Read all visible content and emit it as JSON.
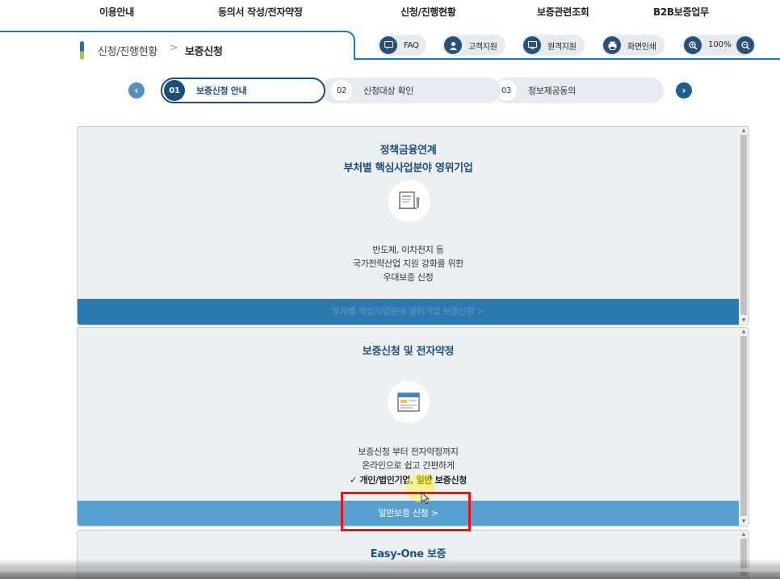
{
  "topnav": {
    "items": [
      "이용안내",
      "동의서 작성/전자약정",
      "신청/진행현황",
      "보증관련조회",
      "B2B보증업무"
    ]
  },
  "breadcrumb": {
    "parent": "신청/진행현황",
    "separator": ">",
    "current": "보증신청"
  },
  "tools": {
    "faq": "FAQ",
    "support": "고객지원",
    "remote": "원격지원",
    "print": "화면인쇄",
    "zoom": "100%",
    "zoom_in_icon": "zoom-in-icon",
    "zoom_out_icon": "zoom-out-icon"
  },
  "steps": [
    {
      "num": "01",
      "label": "보증신청 안내",
      "active": true
    },
    {
      "num": "02",
      "label": "신청대상 확인",
      "active": false
    },
    {
      "num": "03",
      "label": "정보제공동의",
      "active": false
    }
  ],
  "cards": [
    {
      "title_line1": "정책금융연계",
      "title_line2": "부처별 핵심사업분야 영위기업",
      "icon": "document-pen-icon",
      "desc": [
        "반도체, 이차전지 등",
        "국가전략산업 지원 강화를 위한",
        "우대보증 신청"
      ],
      "button": "부처별 핵심사업분야 영위기업 보증신청 >"
    },
    {
      "title": "보증신청 및 전자약정",
      "icon": "browser-window-icon",
      "desc": [
        "보증신청 부터 전자약정까지",
        "온라인으로 쉽고 간편하게"
      ],
      "check": "✓",
      "check_text_pre": "개인/법인기업,",
      "check_text_hl": "일반",
      "check_text_post": "보증신청",
      "button": "일반보증 신청 >"
    },
    {
      "title": "Easy-One 보증"
    }
  ],
  "colors": {
    "brand_blue": "#1e77b3",
    "dark_navy": "#1e4e78",
    "button_blue": "#2b79ad",
    "highlight_red": "#e8131a"
  }
}
